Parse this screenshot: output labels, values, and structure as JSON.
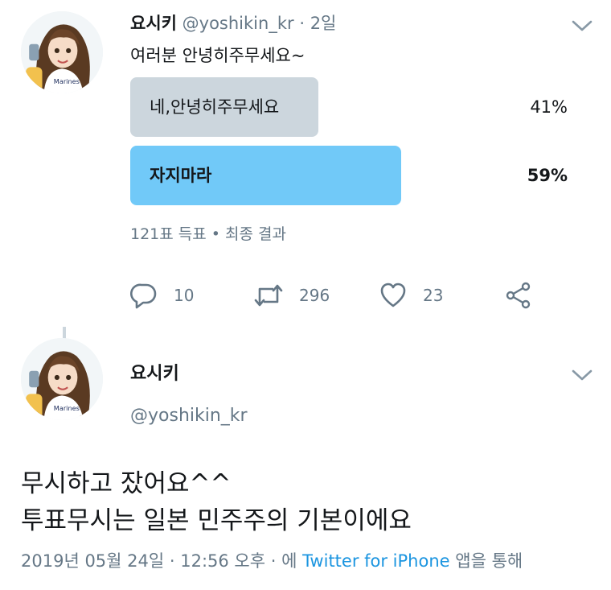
{
  "tweet1": {
    "display_name": "요시키",
    "handle": "@yoshikin_kr",
    "separator": "·",
    "time": "2일",
    "text": "여러분 안녕히주무세요~",
    "poll": {
      "options": [
        {
          "label": "네,안녕히주무세요",
          "percent_text": "41%",
          "percent": 41,
          "winner": false
        },
        {
          "label": "자지마라",
          "percent_text": "59%",
          "percent": 59,
          "winner": true
        }
      ],
      "meta": "121표 득표 • 최종 결과"
    },
    "actions": {
      "reply_count": "10",
      "retweet_count": "296",
      "like_count": "23"
    }
  },
  "tweet2": {
    "display_name": "요시키",
    "handle": "@yoshikin_kr",
    "text_line1": "무시하고 잤어요^^",
    "text_line2": "투표무시는 일본 민주주의 기본이에요",
    "footer_prefix": "2019년 05월 24일 · 12:56 오후 · 에 ",
    "footer_source": "Twitter for iPhone",
    "footer_suffix": " 앱을 통해"
  },
  "colors": {
    "text": "#14171a",
    "muted": "#657786",
    "link": "#1b95e0",
    "poll_winner": "#71c9f8",
    "poll_other": "#ccd6dd"
  },
  "icons": [
    "chevron-down-icon",
    "reply-icon",
    "retweet-icon",
    "like-icon",
    "share-icon"
  ]
}
